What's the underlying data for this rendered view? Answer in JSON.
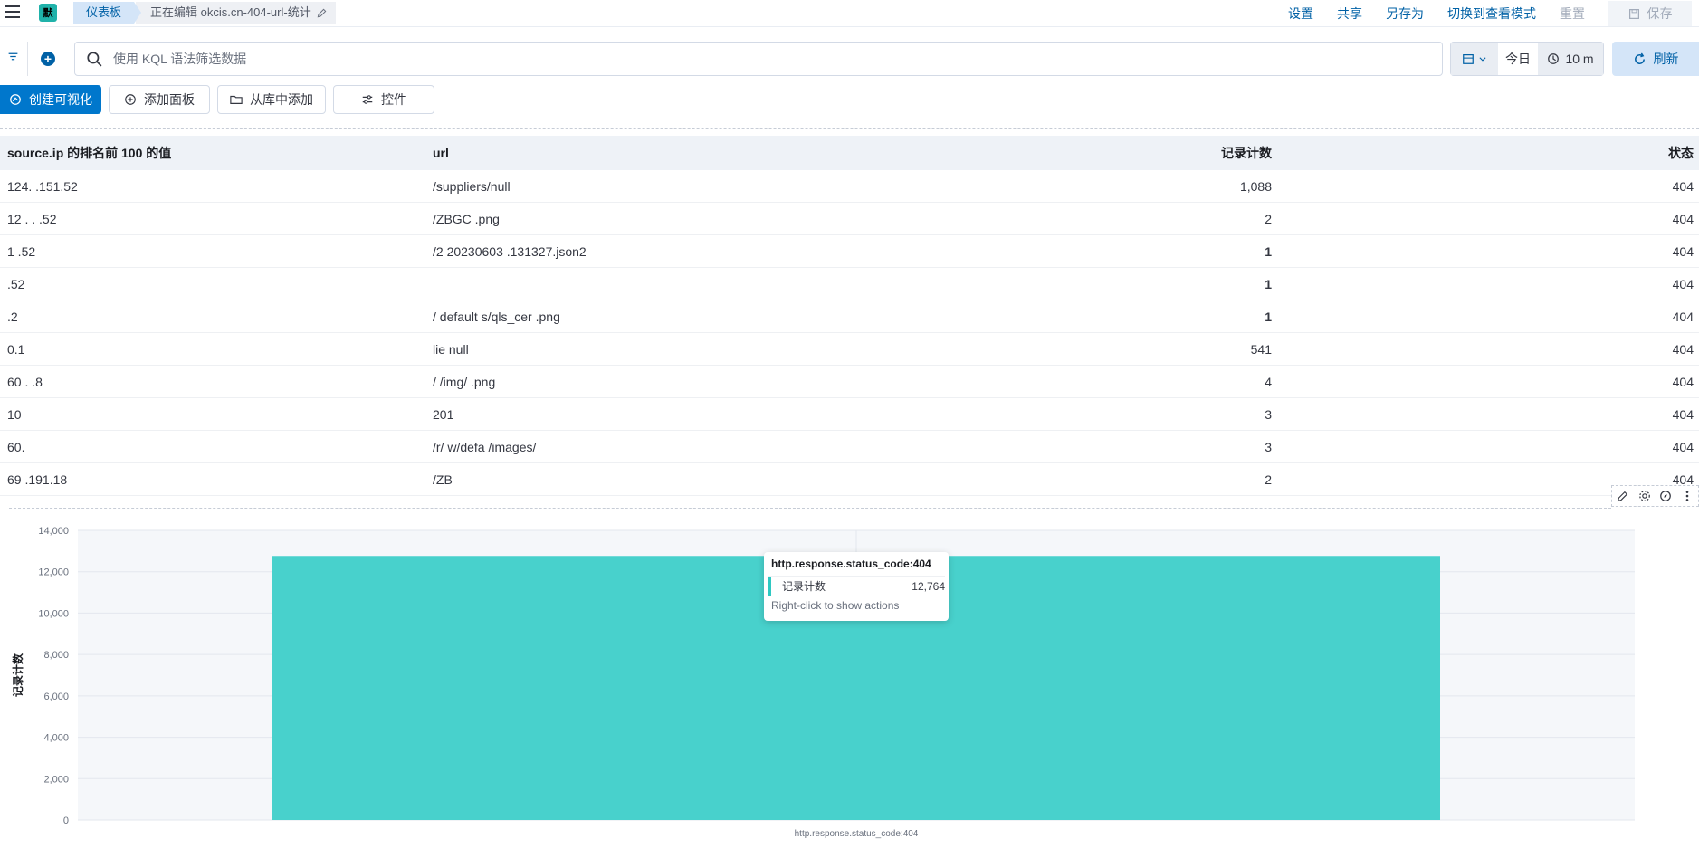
{
  "header": {
    "space_badge": "默",
    "breadcrumb_dashboards": "仪表板",
    "breadcrumb_editing": "正在编辑 okcis.cn-404-url-统计",
    "links": [
      "设置",
      "共享",
      "另存为",
      "切换到查看模式"
    ],
    "reset_label": "重置",
    "save_label": "保存"
  },
  "query": {
    "placeholder": "使用 KQL 语法筛选数据",
    "today_label": "今日",
    "refresh_interval": "10 m",
    "refresh_label": "刷新"
  },
  "toolbar": {
    "create_visualization": "创建可视化",
    "add_panel": "添加面板",
    "add_from_library": "从库中添加",
    "controls": "控件"
  },
  "table": {
    "columns": [
      "source.ip 的排名前 100 的值",
      "url",
      "记录计数",
      "状态"
    ],
    "rows": [
      [
        "124.  .151.52",
        "/suppliers/null",
        "1,088",
        "404"
      ],
      [
        "12 .  . .52",
        "/ZBGC                    .png",
        "2",
        "404"
      ],
      [
        "1     .52",
        "/2         20230603      .131327.json2",
        "1",
        "404"
      ],
      [
        "        .52",
        "            ",
        "1",
        "404"
      ],
      [
        "  .2",
        "           / default    s/qls_cer  .png",
        "1",
        "404"
      ],
      [
        "0.1",
        "     lie  null",
        "541",
        "404"
      ],
      [
        "60  .   .8",
        "        /        /img/    .png",
        "4",
        "404"
      ],
      [
        "   10",
        "              201",
        "3",
        "404"
      ],
      [
        "60.",
        "/r/          w/defa   /images/",
        "3",
        "404"
      ],
      [
        "69   .191.18",
        "/ZB",
        "2",
        "404"
      ]
    ]
  },
  "chart_data": {
    "type": "bar",
    "categories": [
      "http.response.status_code:404"
    ],
    "series": [
      {
        "name": "记录计数",
        "values": [
          12764
        ]
      }
    ],
    "xlabel": "http.response.status_code:404",
    "ylabel": "记录计数",
    "ylim": [
      0,
      14000
    ],
    "yticks": [
      "0",
      "2,000",
      "4,000",
      "6,000",
      "8,000",
      "10,000",
      "12,000",
      "14,000"
    ],
    "grid": true,
    "bar_color": "#48d1cc"
  },
  "tooltip": {
    "title": "http.response.status_code:404",
    "label": "记录计数",
    "value": "12,764",
    "hint": "Right-click to show actions"
  }
}
